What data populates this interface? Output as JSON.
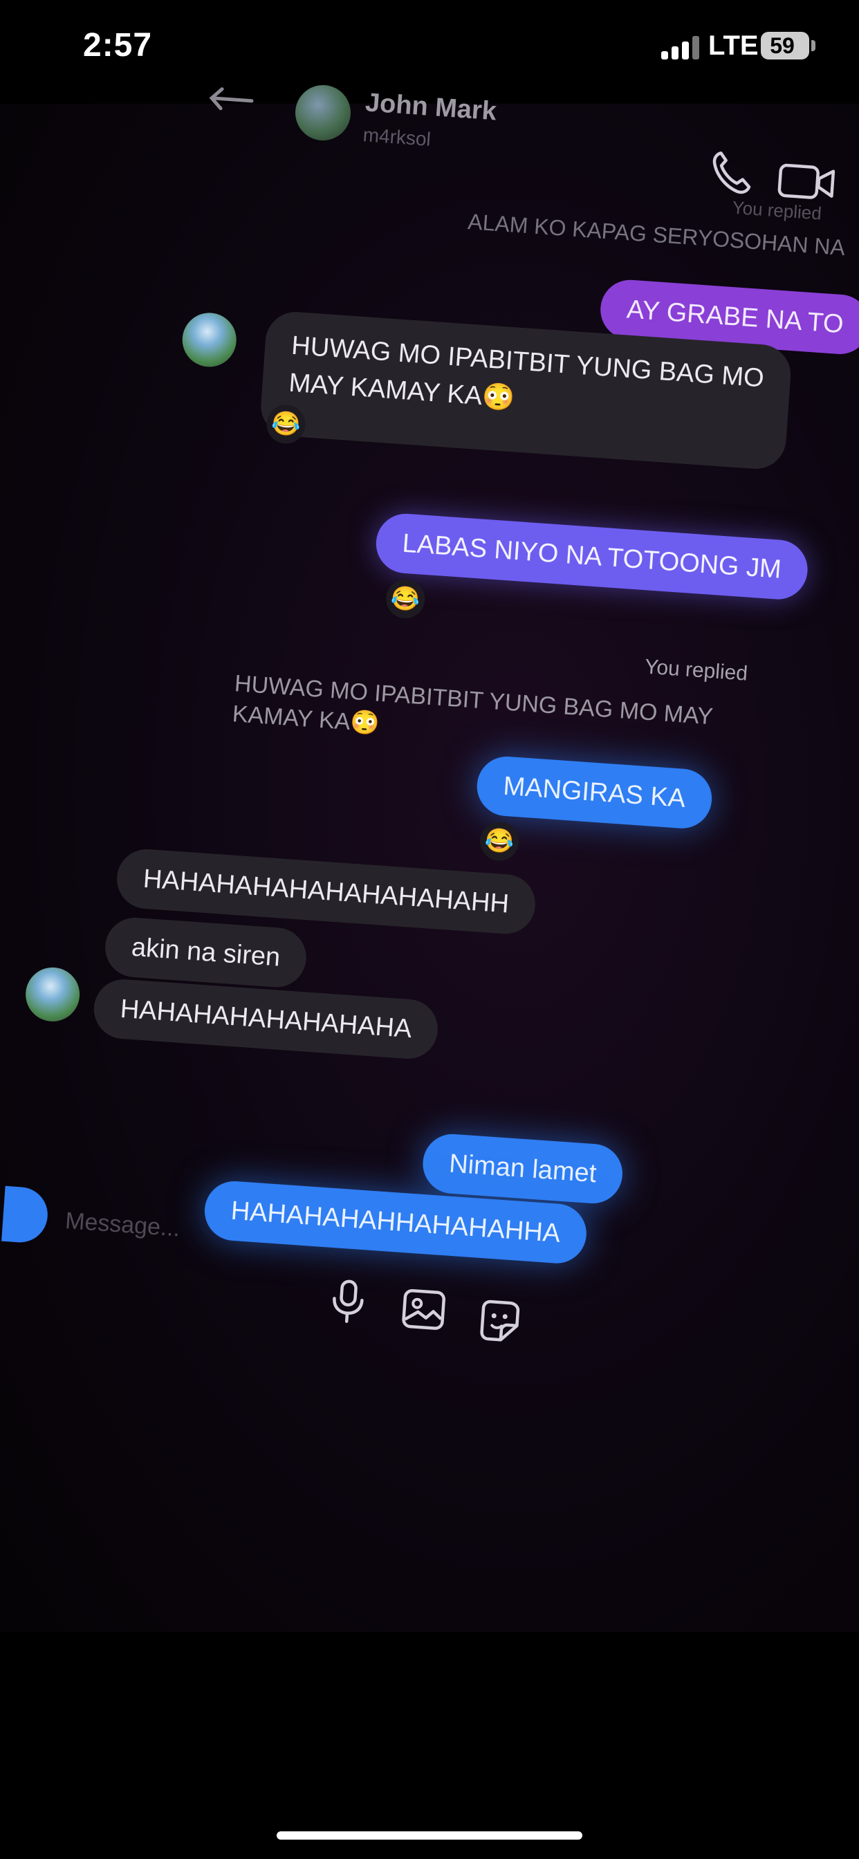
{
  "status_bar": {
    "time": "2:57",
    "network": "LTE",
    "battery_level": "59"
  },
  "header": {
    "contact_name": "John Mark",
    "contact_handle": "m4rksol",
    "icons": [
      "back-arrow-icon",
      "phone-icon",
      "video-camera-icon"
    ]
  },
  "conversation": {
    "top_reply_label": "You replied",
    "quoted_top": "ALAM KO KAPAG SERYOSOHAN NA",
    "msg_ay_grabe": "AY GRABE NA TO",
    "msg_huwag_line1": "HUWAG MO IPABITBIT YUNG BAG MO",
    "msg_huwag_line2": "MAY KAMAY KA",
    "emoji_flushed": "😳",
    "emoji_laugh": "😂",
    "msg_labas": "LABAS NIYO NA TOTOONG JM",
    "reply_label": "You replied",
    "quoted_line1": "HUWAG MO IPABITBIT YUNG BAG MO MAY",
    "quoted_line2": "KAMAY KA",
    "msg_mangiras": "MANGIRAS KA",
    "msg_haha_long": "HAHAHAHAHAHAHAHAHAHH",
    "msg_akin": "akin na siren",
    "msg_haha_short": "HAHAHAHAHAHAHAHA",
    "msg_niman": "Niman lamet",
    "msg_haha_blue": "HAHAHAHAHHAHAHAHHA"
  },
  "composer": {
    "placeholder": "Message...",
    "icons": [
      "microphone-icon",
      "image-icon",
      "sticker-icon"
    ]
  },
  "colors": {
    "purple_bubble": "#8a3fd6",
    "indigo_bubble": "#6d5ef0",
    "blue_bubble": "#2f7ef3",
    "incoming_bubble": "#26242a"
  }
}
